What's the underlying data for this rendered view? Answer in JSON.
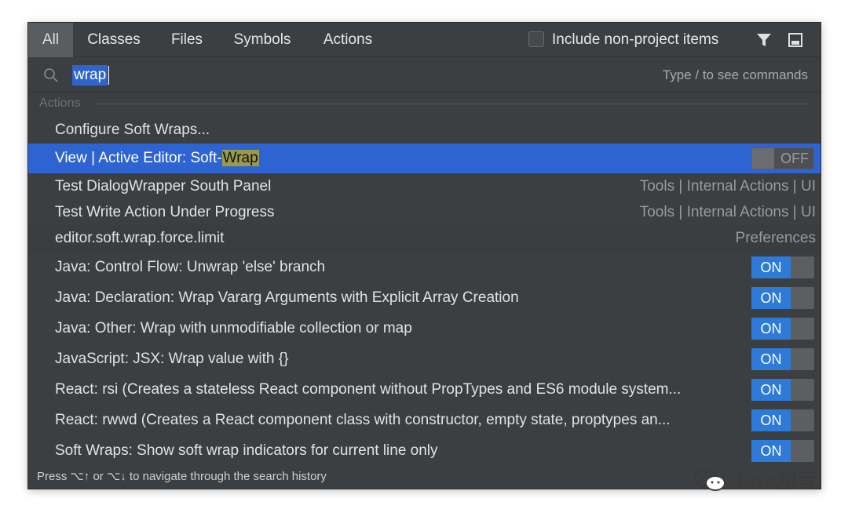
{
  "tabs": [
    {
      "label": "All",
      "active": true
    },
    {
      "label": "Classes",
      "active": false
    },
    {
      "label": "Files",
      "active": false
    },
    {
      "label": "Symbols",
      "active": false
    },
    {
      "label": "Actions",
      "active": false
    }
  ],
  "include_checkbox": {
    "label": "Include non-project items",
    "checked": false
  },
  "search": {
    "value": "wrap",
    "hint": "Type / to see commands"
  },
  "group_header": "Actions",
  "rows": [
    {
      "label": "Configure Soft Wraps...",
      "location": ""
    },
    {
      "label_prefix": "View | Active Editor: Soft-",
      "label_highlight": "Wrap",
      "toggle": "OFF",
      "selected": true
    },
    {
      "label": "Test DialogWrapper South Panel",
      "location": "Tools | Internal Actions | UI"
    },
    {
      "label": "Test Write Action Under Progress",
      "location": "Tools | Internal Actions | UI"
    },
    {
      "label": "editor.soft.wrap.force.limit",
      "location": "Preferences"
    },
    {
      "label": "Java: Control Flow: Unwrap 'else' branch",
      "toggle": "ON"
    },
    {
      "label": "Java: Declaration: Wrap Vararg Arguments with Explicit Array Creation",
      "toggle": "ON"
    },
    {
      "label": "Java: Other: Wrap with unmodifiable collection or map",
      "toggle": "ON"
    },
    {
      "label": "JavaScript: JSX: Wrap value with {}",
      "toggle": "ON"
    },
    {
      "label": "React: rsi (Creates a stateless React component without PropTypes and ES6 module system...",
      "toggle": "ON"
    },
    {
      "label": "React: rwwd (Creates a React component class with constructor, empty state, proptypes an...",
      "toggle": "ON"
    },
    {
      "label": "Soft Wraps: Show soft wrap indicators for current line only",
      "toggle": "ON"
    }
  ],
  "footer": "Press ⌥↑ or ⌥↓ to navigate through the search history",
  "watermark": "Java知音",
  "colors": {
    "background": "#3c3f41",
    "selection": "#2e64d1",
    "toggle_on": "#2d7ad8",
    "highlight": "#9a9a4a"
  }
}
